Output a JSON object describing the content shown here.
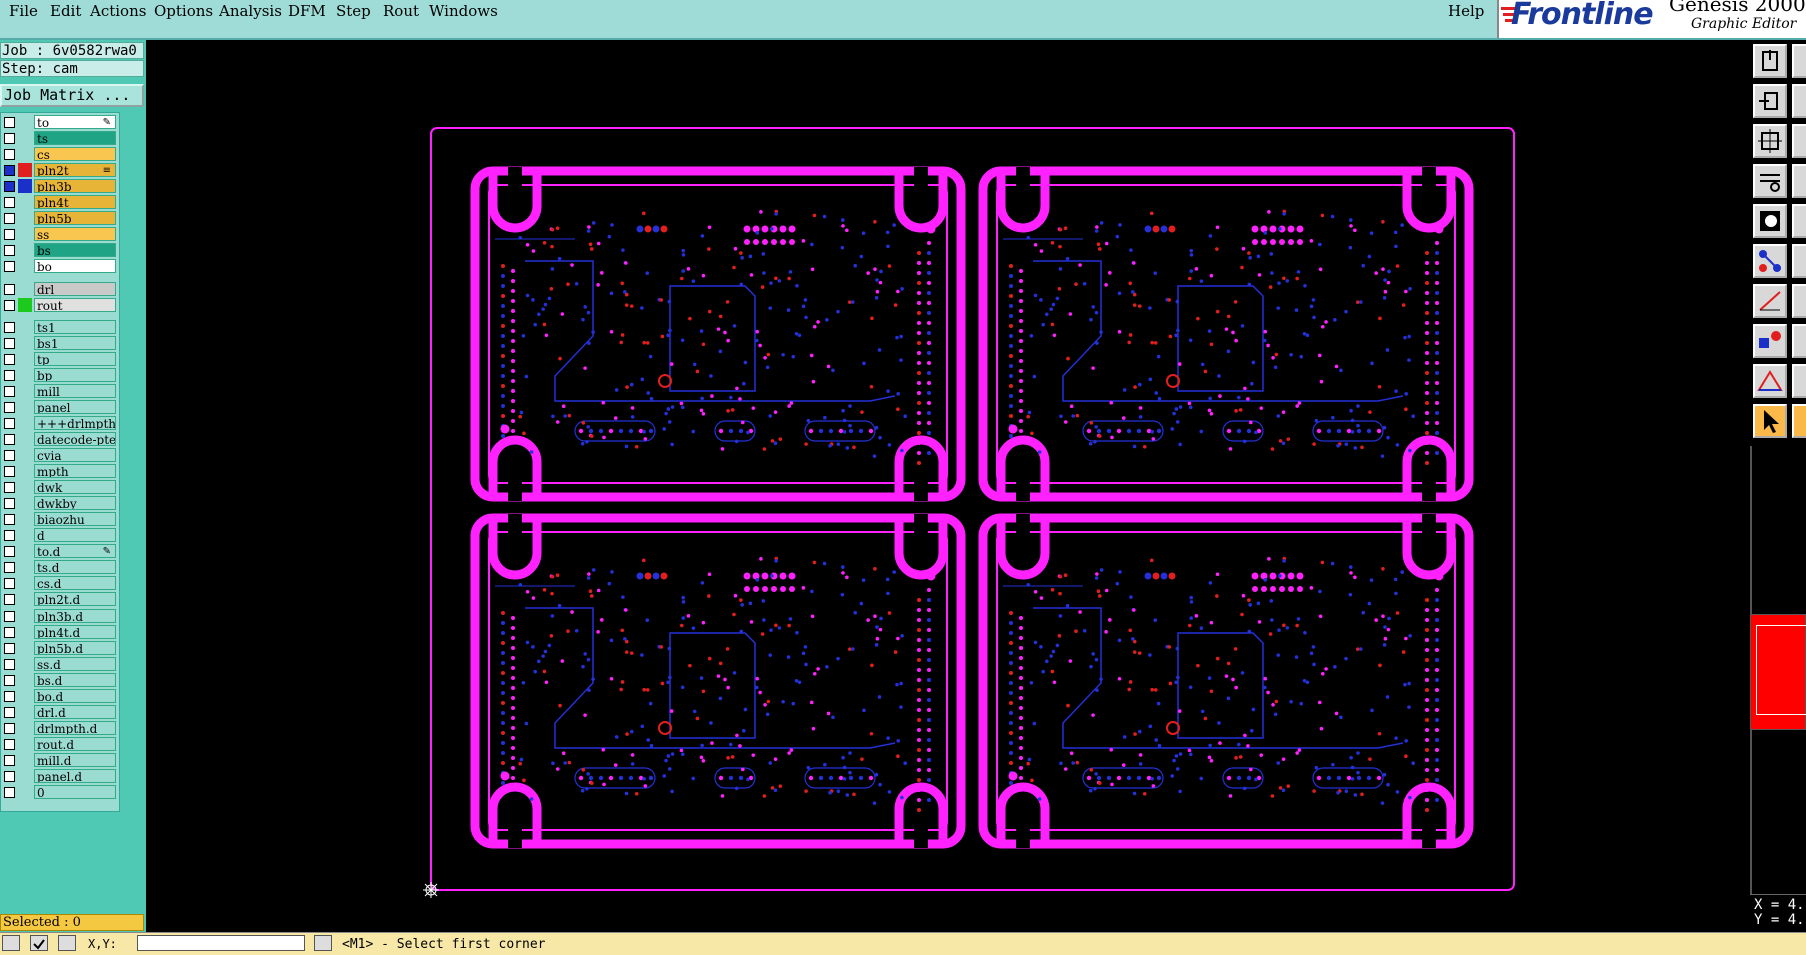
{
  "menu": [
    "File",
    "Edit",
    "Actions",
    "Options",
    "Analysis",
    "DFM",
    "Step",
    "Rout",
    "Windows"
  ],
  "help": "Help",
  "brand": {
    "logo": "Frontline",
    "product": "Genesis 2000",
    "subtitle": "Graphic Editor"
  },
  "job": {
    "job_label": "Job : 6v0582rwa0",
    "step_label": "Step: cam",
    "matrix_button": "Job Matrix ..."
  },
  "layers": [
    {
      "name": "to",
      "color": "#ffffff",
      "checked": false,
      "mark": "✎"
    },
    {
      "name": "ts",
      "color": "#1fa586",
      "checked": false
    },
    {
      "name": "cs",
      "color": "#f9c74f",
      "checked": false
    },
    {
      "name": "pln2t",
      "color": "#e8b437",
      "checked": true,
      "swatch": "#e21f1f",
      "mark": "≡"
    },
    {
      "name": "pln3b",
      "color": "#e8b437",
      "checked": true,
      "swatch": "#1b2fc9"
    },
    {
      "name": "pln4t",
      "color": "#e8b437",
      "checked": false
    },
    {
      "name": "pln5b",
      "color": "#e8b437",
      "checked": false
    },
    {
      "name": "ss",
      "color": "#f9c74f",
      "checked": false
    },
    {
      "name": "bs",
      "color": "#1fa586",
      "checked": false
    },
    {
      "name": "bo",
      "color": "#ffffff",
      "checked": false
    },
    {
      "name": "drl",
      "color": "#c9c9c9",
      "checked": false
    },
    {
      "name": "rout",
      "color": "#e0e0e0",
      "checked": false,
      "swatch": "#1ec91e"
    },
    {
      "name": "ts1",
      "color": "#9bdcd2",
      "checked": false
    },
    {
      "name": "bs1",
      "color": "#9bdcd2",
      "checked": false
    },
    {
      "name": "tp",
      "color": "#9bdcd2",
      "checked": false
    },
    {
      "name": "bp",
      "color": "#9bdcd2",
      "checked": false
    },
    {
      "name": "mill",
      "color": "#9bdcd2",
      "checked": false
    },
    {
      "name": "panel",
      "color": "#9bdcd2",
      "checked": false
    },
    {
      "name": "+++drlmpth",
      "color": "#9bdcd2",
      "checked": false
    },
    {
      "name": "datecode-pte",
      "color": "#9bdcd2",
      "checked": false
    },
    {
      "name": "cvia",
      "color": "#9bdcd2",
      "checked": false
    },
    {
      "name": "mpth",
      "color": "#9bdcd2",
      "checked": false
    },
    {
      "name": "dwk",
      "color": "#9bdcd2",
      "checked": false
    },
    {
      "name": "dwkby",
      "color": "#9bdcd2",
      "checked": false
    },
    {
      "name": "biaozhu",
      "color": "#9bdcd2",
      "checked": false
    },
    {
      "name": "d",
      "color": "#9bdcd2",
      "checked": false
    },
    {
      "name": "to.d",
      "color": "#9bdcd2",
      "checked": false,
      "mark": "✎"
    },
    {
      "name": "ts.d",
      "color": "#9bdcd2",
      "checked": false
    },
    {
      "name": "cs.d",
      "color": "#9bdcd2",
      "checked": false
    },
    {
      "name": "pln2t.d",
      "color": "#9bdcd2",
      "checked": false
    },
    {
      "name": "pln3b.d",
      "color": "#9bdcd2",
      "checked": false
    },
    {
      "name": "pln4t.d",
      "color": "#9bdcd2",
      "checked": false
    },
    {
      "name": "pln5b.d",
      "color": "#9bdcd2",
      "checked": false
    },
    {
      "name": "ss.d",
      "color": "#9bdcd2",
      "checked": false
    },
    {
      "name": "bs.d",
      "color": "#9bdcd2",
      "checked": false
    },
    {
      "name": "bo.d",
      "color": "#9bdcd2",
      "checked": false
    },
    {
      "name": "drl.d",
      "color": "#9bdcd2",
      "checked": false
    },
    {
      "name": "drlmpth.d",
      "color": "#9bdcd2",
      "checked": false
    },
    {
      "name": "rout.d",
      "color": "#9bdcd2",
      "checked": false
    },
    {
      "name": "mill.d",
      "color": "#9bdcd2",
      "checked": false
    },
    {
      "name": "panel.d",
      "color": "#9bdcd2",
      "checked": false
    },
    {
      "name": "0",
      "color": "#9bdcd2",
      "checked": false
    }
  ],
  "selected": "Selected : 0",
  "coords": {
    "x": "X = 4.",
    "y": "Y = 4."
  },
  "status": {
    "xy_label": "X,Y:",
    "input_value": "",
    "message": "<M1> - Select first corner"
  },
  "colors": {
    "outline": "#ff22ff",
    "plane_red": "#e21f1f",
    "plane_blue": "#2430d8",
    "active_view": "#ff0000"
  }
}
